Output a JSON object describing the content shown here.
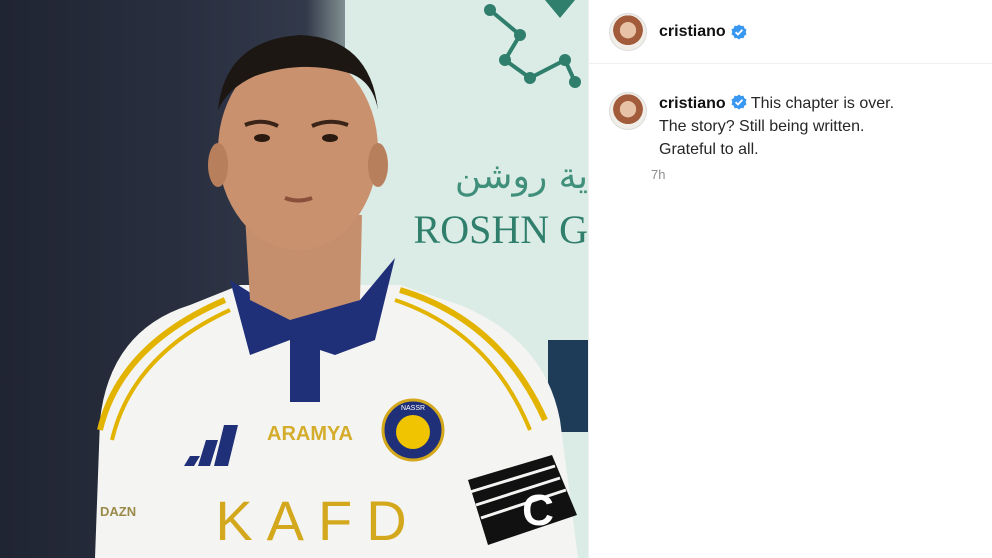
{
  "post": {
    "username": "cristiano",
    "caption_line1": "This chapter is over.",
    "caption_line2": "The story? Still being written.",
    "caption_line3": "Grateful to all.",
    "timestamp": "7h"
  },
  "photo": {
    "sponsor_ar": "ية روشن",
    "sponsor_en": "ROSHN G",
    "shirt_sponsor": "KAFD",
    "shirt_brand": "ARAMYA",
    "captain_band": "C",
    "crest_text": "NASSR",
    "sleeve_text": "DAZN"
  },
  "colors": {
    "verified": "#3897f0",
    "jersey": "#f4f4f2",
    "jersey_trim": "#1f2f78",
    "gold": "#e2b400",
    "banner_green": "#2f7f6c"
  }
}
